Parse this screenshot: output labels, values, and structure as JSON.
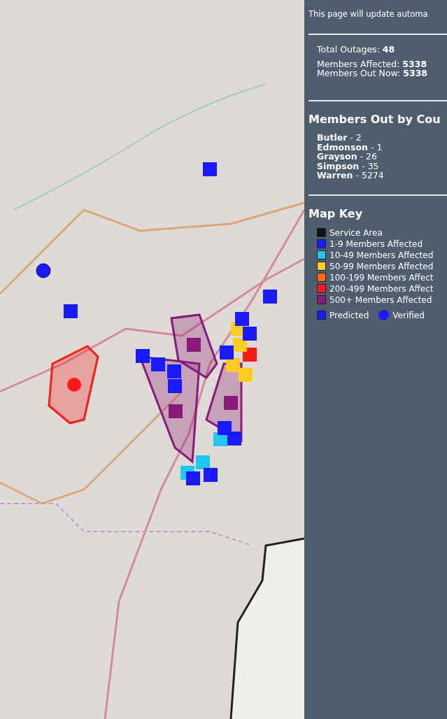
{
  "notice": "This page will update automa",
  "summary": [
    {
      "label": "Total Outages:",
      "value": "48"
    },
    {
      "label": "Members Affected:",
      "value": "5338"
    },
    {
      "label": "Members Out Now:",
      "value": "5338"
    }
  ],
  "county_section": {
    "title": "Members Out by Cou",
    "counties": [
      {
        "name": "Butler",
        "count": "- 2"
      },
      {
        "name": "Edmonson",
        "count": "- 1"
      },
      {
        "name": "Grayson",
        "count": "- 26"
      },
      {
        "name": "Simpson",
        "count": "- 35"
      },
      {
        "name": "Warren",
        "count": "- 5274"
      }
    ]
  },
  "map_key": {
    "title": "Map Key",
    "items": [
      {
        "label": "Service Area",
        "color": "#111111"
      },
      {
        "label": "1-9 Members Affected",
        "color": "#1a1aff"
      },
      {
        "label": "10-49 Members Affected",
        "color": "#1ec8f0"
      },
      {
        "label": "50-99 Members Affected",
        "color": "#ffcc22"
      },
      {
        "label": "100-199 Members Affect",
        "color": "#ff6a10"
      },
      {
        "label": "200-499 Members Affect",
        "color": "#ff1a1a"
      },
      {
        "label": "500+ Members Affected",
        "color": "#8a1a7a"
      }
    ],
    "markers": [
      {
        "kind": "square",
        "label": "Predicted"
      },
      {
        "kind": "circle",
        "label": "Verified"
      }
    ]
  }
}
